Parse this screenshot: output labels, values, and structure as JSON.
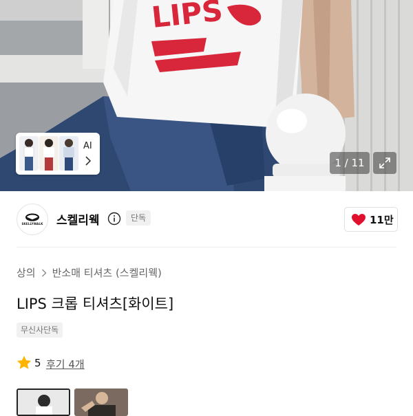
{
  "gallery": {
    "ai_label": "AI",
    "counter": "1 / 11",
    "photo_print_text": "LIPS"
  },
  "brand": {
    "name": "스켈리웩",
    "logo_text": "SKELLYWALK",
    "exclusive_badge": "단독",
    "like_count": "11만"
  },
  "product": {
    "breadcrumb": [
      "상의",
      "반소매 티셔츠 (스켈리웩)"
    ],
    "title": "LIPS 크롭 티셔츠[화이트]",
    "badge": "무신사단독",
    "rating": "5",
    "review_link": "후기 4개"
  },
  "colors": {
    "heart": "#e1112d",
    "star": "#ffb400",
    "print_red": "#d8263b"
  },
  "icons": {
    "info": "info-icon",
    "heart": "heart-icon",
    "star": "star-icon",
    "expand": "expand-icon",
    "chevron": "chevron-right-icon"
  }
}
